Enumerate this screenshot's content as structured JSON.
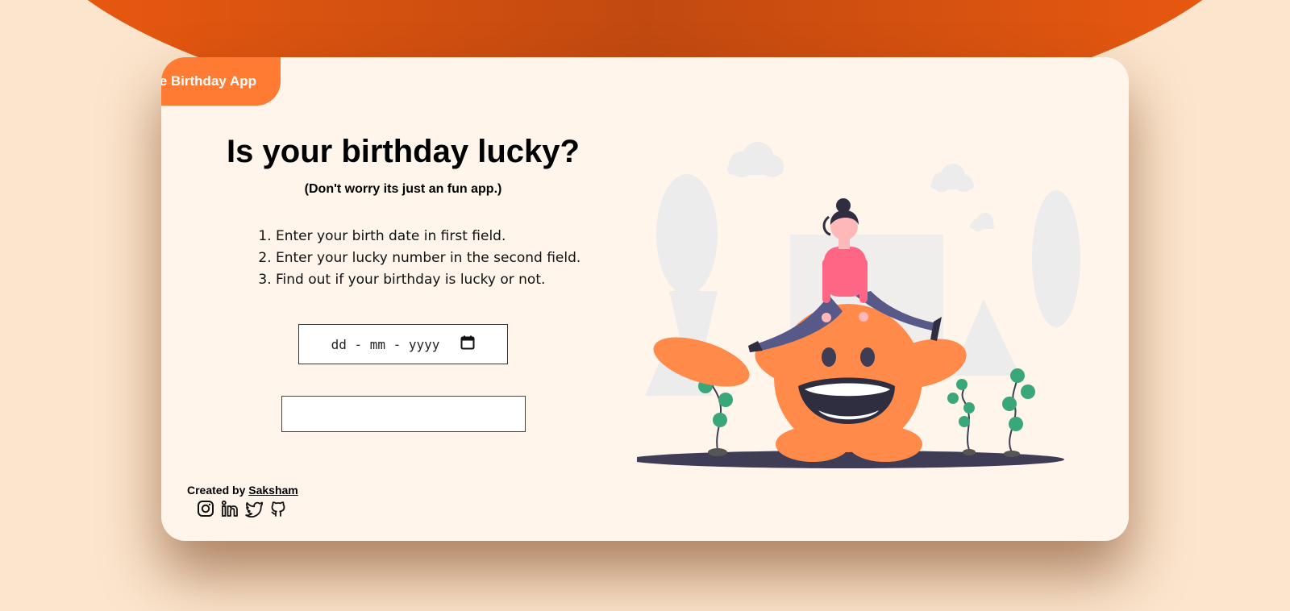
{
  "app": {
    "tag": "Fate Birthday App"
  },
  "hero": {
    "title": "Is your birthday lucky?",
    "subtitle": "(Don't worry its just an fun app.)"
  },
  "instructions": [
    "Enter your birth date in first field.",
    "Enter your lucky number in the second field.",
    "Find out if your birthday is lucky or not."
  ],
  "form": {
    "date_placeholder": "dd - mm - yyyy",
    "lucky_number_value": ""
  },
  "footer": {
    "created_by": "Created by",
    "author": "Saksham",
    "socials": [
      "instagram-icon",
      "linkedin-icon",
      "twitter-icon",
      "github-icon"
    ]
  },
  "colors": {
    "accent": "#ff7a33",
    "background_blob": "#e85a12",
    "card": "#fff5eb",
    "page": "#fbe5cc",
    "monster": "#ff8a4a",
    "ground": "#3f3d56"
  }
}
